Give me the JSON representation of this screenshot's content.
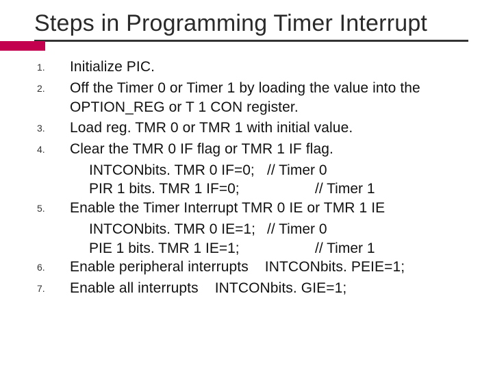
{
  "title": "Steps in Programming Timer Interrupt",
  "items": [
    {
      "n": "1.",
      "text": "Initialize PIC."
    },
    {
      "n": "2.",
      "text": "Off the Timer 0 or Timer 1 by loading the value into the OPTION_REG or T 1 CON register."
    },
    {
      "n": "3.",
      "text": "Load reg. TMR 0 or TMR 1 with initial value."
    },
    {
      "n": "4.",
      "text": "Clear the TMR 0 IF flag or TMR 1 IF flag."
    }
  ],
  "sub4": [
    {
      "code": "INTCONbits. TMR 0 IF=0;",
      "cmt": "// Timer 0"
    },
    {
      "code": "PIR 1 bits. TMR 1 IF=0;",
      "cmt": "// Timer 1"
    }
  ],
  "item5": {
    "n": "5.",
    "text": "Enable the Timer Interrupt TMR 0 IE or TMR 1 IE"
  },
  "sub5": [
    {
      "code": "INTCONbits. TMR 0 IE=1;",
      "cmt": "// Timer 0"
    },
    {
      "code": "PIE 1 bits. TMR 1 IE=1;",
      "cmt": "// Timer 1"
    }
  ],
  "item6": {
    "n": "6.",
    "lead": "Enable peripheral interrupts",
    "tail": "INTCONbits. PEIE=1;"
  },
  "item7": {
    "n": "7.",
    "lead": "Enable all interrupts",
    "tail": "INTCONbits. GIE=1;"
  }
}
